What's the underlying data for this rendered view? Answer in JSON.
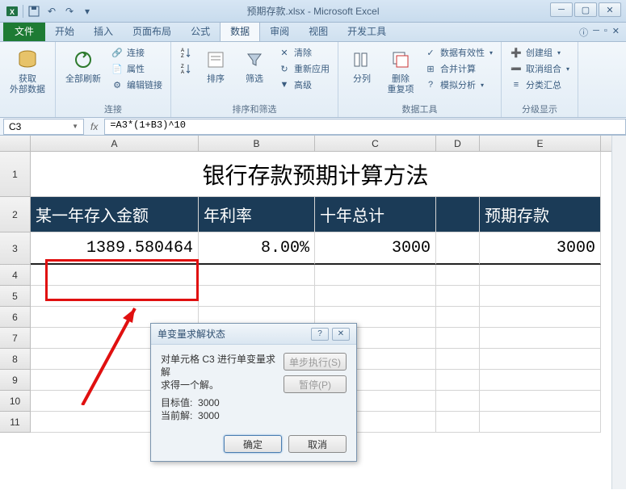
{
  "app": {
    "title": "预期存款.xlsx - Microsoft Excel"
  },
  "tabs": {
    "file": "文件",
    "home": "开始",
    "insert": "插入",
    "layout": "页面布局",
    "formulas": "公式",
    "data": "数据",
    "review": "审阅",
    "view": "视图",
    "dev": "开发工具"
  },
  "ribbon": {
    "get_data": "获取\n外部数据",
    "refresh_all": "全部刷新",
    "connections": "连接",
    "properties": "属性",
    "edit_links": "编辑链接",
    "group_conn": "连接",
    "sort_asc": "升",
    "sort_desc": "降",
    "sort": "排序",
    "filter": "筛选",
    "clear": "清除",
    "reapply": "重新应用",
    "advanced": "高级",
    "group_sort": "排序和筛选",
    "text_to_col": "分列",
    "remove_dup": "删除\n重复项",
    "validation": "数据有效性",
    "consolidate": "合并计算",
    "whatif": "模拟分析",
    "group_tools": "数据工具",
    "group": "创建组",
    "ungroup": "取消组合",
    "subtotal": "分类汇总",
    "group_outline": "分级显示"
  },
  "formula_bar": {
    "name_box": "C3",
    "formula": "=A3*(1+B3)^10"
  },
  "columns": {
    "A": "A",
    "B": "B",
    "C": "C",
    "D": "D",
    "E": "E"
  },
  "sheet": {
    "title": "银行存款预期计算方法",
    "h_amount": "某一年存入金额",
    "h_rate": "年利率",
    "h_total": "十年总计",
    "h_expect": "预期存款",
    "v_amount": "1389.580464",
    "v_rate": "8.00%",
    "v_total": "3000",
    "v_expect": "3000"
  },
  "dialog": {
    "title": "单变量求解状态",
    "line1": "对单元格 C3 进行单变量求解",
    "line2": "求得一个解。",
    "target_label": "目标值:",
    "target_val": "3000",
    "current_label": "当前解:",
    "current_val": "3000",
    "step": "单步执行(S)",
    "pause": "暂停(P)",
    "ok": "确定",
    "cancel": "取消"
  }
}
